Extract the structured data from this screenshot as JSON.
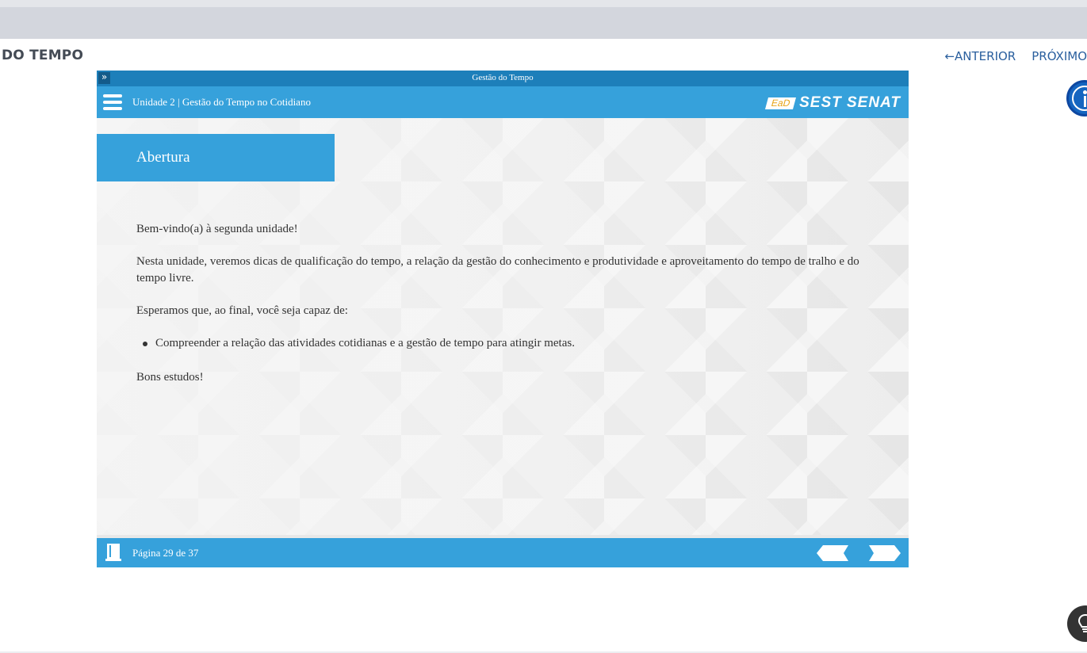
{
  "page": {
    "course_title": "DO TEMPO",
    "nav": {
      "prev_label": "ANTERIOR",
      "next_label": "PRÓXIMO",
      "prev_arrow": "←"
    }
  },
  "frame": {
    "header_title": "Gestão do Tempo",
    "collapse_glyph": "»",
    "unit_title": "Unidade 2 | Gestão do Tempo no Cotidiano",
    "logo": {
      "ead": "EaD",
      "brand": "SEST SENAT"
    },
    "section_title": "Abertura",
    "body": {
      "welcome": "Bem-vindo(a) à segunda unidade!",
      "intro": "Nesta unidade, veremos dicas de qualificação do tempo, a relação da gestão do conhecimento e produtividade e aproveitamento do tempo de tralho e do tempo livre.",
      "expect": "Esperamos que, ao final, você seja capaz de:",
      "goals": [
        "Compreender a relação das atividades cotidianas e a gestão de tempo para atingir metas."
      ],
      "closing": "Bons estudos!"
    },
    "footer": {
      "page_label": "Página 29 de 37"
    }
  },
  "colors": {
    "primary_blue": "#36a1db",
    "dark_blue": "#1d7fba",
    "nav_link": "#2a5f9e"
  },
  "icons": [
    "menu-icon",
    "book-icon",
    "prev-arrow-icon",
    "next-arrow-icon",
    "accessibility-icon",
    "lightbulb-icon",
    "double-chevron-icon"
  ]
}
